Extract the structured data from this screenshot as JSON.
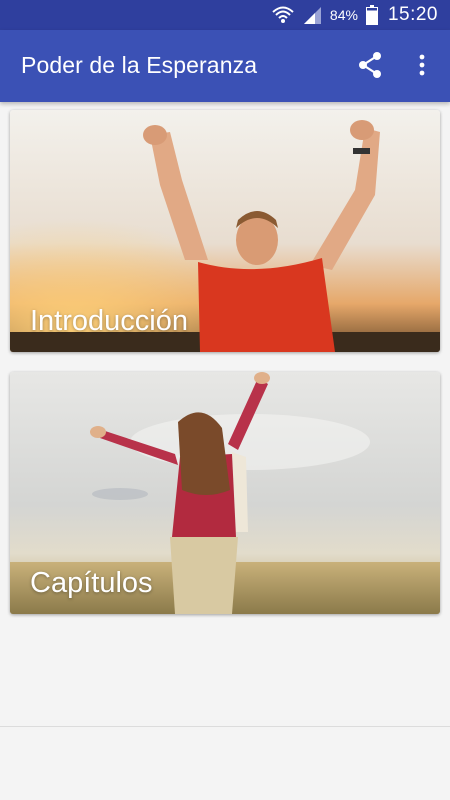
{
  "status_bar": {
    "battery_percent": "84%",
    "time": "15:20",
    "icons": [
      "wifi-icon",
      "signal-icon",
      "battery-icon"
    ]
  },
  "app_bar": {
    "title": "Poder de la Esperanza",
    "actions": [
      "share-icon",
      "more-vert-icon"
    ],
    "color": "#3b51b5",
    "status_color": "#2f3f9e"
  },
  "cards": [
    {
      "label": "Introducción"
    },
    {
      "label": "Capítulos"
    }
  ]
}
